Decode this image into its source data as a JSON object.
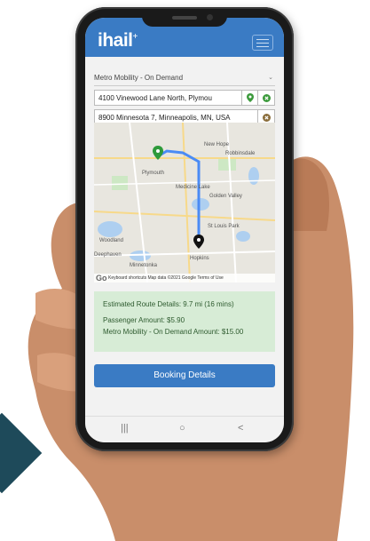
{
  "app": {
    "logo": "ihail",
    "logo_superscript": "+"
  },
  "form": {
    "service_select": "Metro Mobility - On Demand",
    "pickup_address": "4100 Vinewood Lane North, Plymou",
    "dropoff_address": "8900 Minnesota 7, Minneapolis, MN, USA"
  },
  "map": {
    "labels": {
      "new_hope": "New Hope",
      "robbinsdale": "Robbinsdale",
      "plymouth": "Plymouth",
      "medicine_lake": "Medicine Lake",
      "golden_valley": "Golden Valley",
      "st_louis_park": "St Louis Park",
      "woodland": "Woodland",
      "deephaven": "Deephaven",
      "minnetonka": "Minnetonka",
      "hopkins": "Hopkins"
    },
    "credit": "Keyboard shortcuts   Map data ©2021 Google   Terms of Use",
    "google": "Go"
  },
  "details": {
    "route": "Estimated Route Details: 9.7 mi (16 mins)",
    "passenger_amount": "Passenger Amount: $5.90",
    "metro_amount": "Metro Mobility - On Demand Amount: $15.00"
  },
  "booking_button": "Booking Details",
  "navbar": {
    "recent": "|||",
    "home": "○",
    "back": "<"
  },
  "colors": {
    "primary": "#3a7bc4",
    "details_bg": "#d7ecd6",
    "route_line": "#4a8bf5",
    "brand_dark": "#1e4a5a"
  }
}
